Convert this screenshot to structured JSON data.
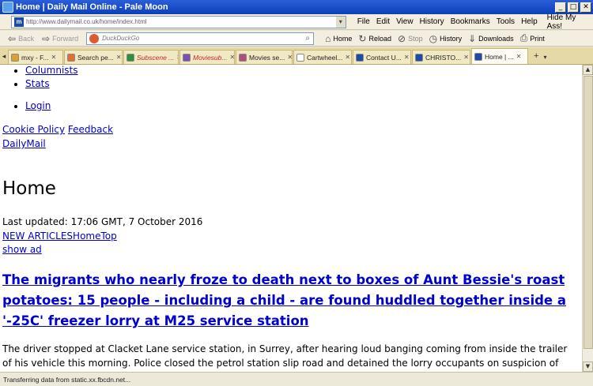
{
  "window": {
    "title": "Home | Daily Mail Online - Pale Moon"
  },
  "address": {
    "url": "http://www.dailymail.co.uk/home/index.html",
    "site_icon": "m"
  },
  "menu": [
    "File",
    "Edit",
    "View",
    "History",
    "Bookmarks",
    "Tools",
    "Help",
    "Hide My Ass!"
  ],
  "nav": {
    "back": "Back",
    "forward": "Forward",
    "search_placeholder": "DuckDuckGo",
    "home": "Home",
    "reload": "Reload",
    "stop": "Stop",
    "history": "History",
    "downloads": "Downloads",
    "print": "Print"
  },
  "tabs": [
    {
      "label": "mxy - F...",
      "color": "#e0a030",
      "style": "normal"
    },
    {
      "label": "Search pe...",
      "color": "#e07030",
      "style": "normal"
    },
    {
      "label": "Subscene ...",
      "color": "#2f8f3a",
      "style": "red"
    },
    {
      "label": "Moviesub...",
      "color": "#7a4fb0",
      "style": "red"
    },
    {
      "label": "Movies se...",
      "color": "#b04f7a",
      "style": "normal"
    },
    {
      "label": "Cartwheel...",
      "color": "#ffffff",
      "style": "normal"
    },
    {
      "label": "Contact U...",
      "color": "#1b4aa8",
      "style": "normal"
    },
    {
      "label": "CHRISTO...",
      "color": "#1b4aa8",
      "style": "normal"
    },
    {
      "label": "Home | ...",
      "color": "#1b4aa8",
      "style": "active"
    }
  ],
  "page": {
    "list_top": [
      "Columnists",
      "Stats"
    ],
    "login": "Login",
    "cookie_policy": "Cookie Policy",
    "feedback": "Feedback",
    "dailymail": "DailyMail",
    "heading": "Home",
    "last_updated": "Last updated: 17:06 GMT, 7 October 2016",
    "new_articles": "NEW ARTICLES",
    "home_link": "Home",
    "top_link": "Top",
    "show_ad": "show ad",
    "headline": "The migrants who nearly froze to death next to boxes of Aunt Bessie's roast potatoes: 15 people - including a child - are found huddled together inside a '-25C' freezer lorry at M25 service station",
    "body": "The driver stopped at Clacket Lane service station, in Surrey, after hearing loud banging coming from inside the trailer of his vehicle this morning. Police closed the petrol station slip road and detained the lorry occupants on suspicion of illegal entry into the country."
  },
  "status": "Transferring data from static.xx.fbcdn.net..."
}
